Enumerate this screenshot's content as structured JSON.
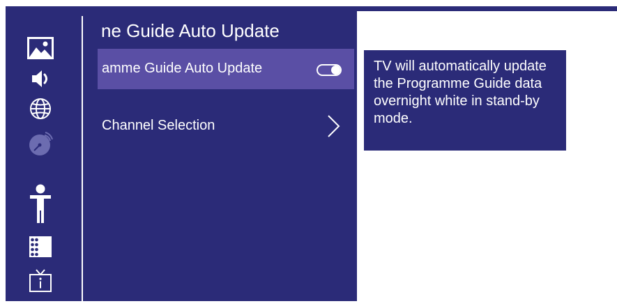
{
  "colors": {
    "background": "#2b2b78",
    "selected_item": "#5a4fa5",
    "text": "#ffffff",
    "info_panel": "#ffffff",
    "disabled_icon": "#6c6cb0"
  },
  "sidebar": {
    "icons": [
      {
        "name": "picture-icon",
        "state": "normal"
      },
      {
        "name": "sound-icon",
        "state": "normal"
      },
      {
        "name": "network-icon",
        "state": "normal"
      },
      {
        "name": "satellite-icon",
        "state": "disabled"
      },
      {
        "name": "accessibility-icon",
        "state": "normal"
      },
      {
        "name": "channel-list-icon",
        "state": "normal"
      },
      {
        "name": "tv-info-icon",
        "state": "normal"
      }
    ]
  },
  "menu": {
    "title": "ne Guide Auto Update",
    "items": [
      {
        "label": "amme Guide Auto Update",
        "control": "toggle",
        "toggle_on": true,
        "selected": true
      },
      {
        "label": "Channel Selection",
        "control": "chevron-right-icon",
        "selected": false
      }
    ]
  },
  "info": {
    "text": "TV will automatically update the Programme Guide data overnight white in stand-by mode."
  }
}
